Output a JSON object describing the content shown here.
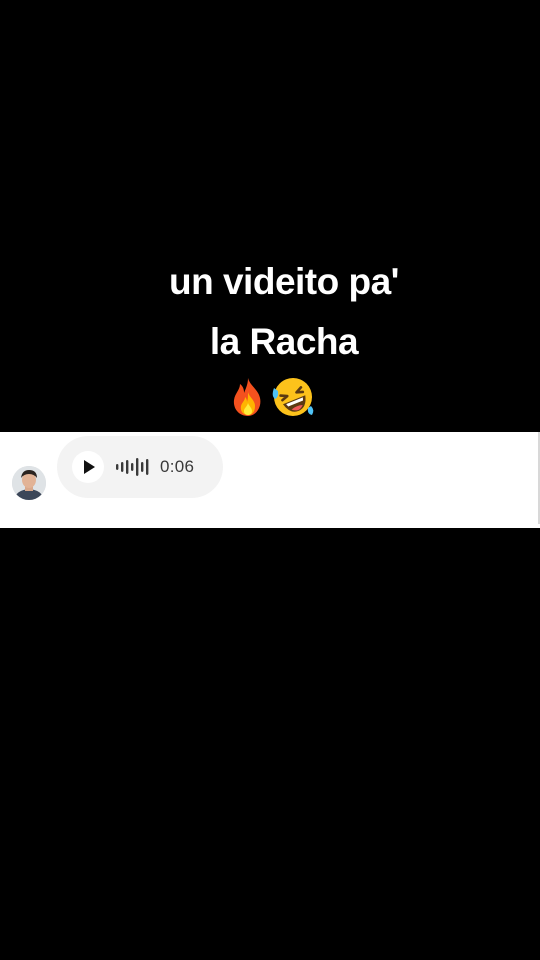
{
  "caption": {
    "line1": "un videito pa'",
    "line2": "la Racha",
    "emojis": [
      "fire-emoji",
      "rolling-on-floor-laughing-emoji"
    ]
  },
  "voice_message": {
    "duration": "0:06",
    "avatar": "user-avatar",
    "play_icon": "play-icon",
    "waveform_icon": "waveform-icon"
  },
  "colors": {
    "background": "#000000",
    "caption_text": "#ffffff",
    "card_background": "#ffffff",
    "bubble_background": "#f3f3f3",
    "duration_text": "#3a3a3a"
  }
}
